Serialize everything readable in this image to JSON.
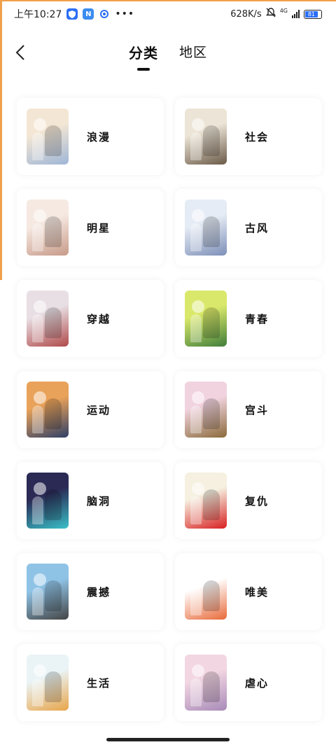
{
  "status_bar": {
    "time": "上午10:27",
    "network_speed": "628K/s",
    "network_type": "4G",
    "battery_level": "81",
    "icons": [
      "shield-icon",
      "n-app-icon",
      "circle-app-icon",
      "more-dots-icon",
      "mute-bell-icon",
      "signal-icon",
      "battery-icon"
    ]
  },
  "header": {
    "back_icon": "chevron-left-icon",
    "tabs": [
      {
        "label": "分类",
        "active": true
      },
      {
        "label": "地区",
        "active": false
      }
    ]
  },
  "categories": [
    {
      "label": "浪漫",
      "thumb_colors": [
        "#f3e6d4",
        "#9fb6d6"
      ]
    },
    {
      "label": "社会",
      "thumb_colors": [
        "#ece4d6",
        "#6b5a48"
      ]
    },
    {
      "label": "明星",
      "thumb_colors": [
        "#f6e9e2",
        "#c79a88"
      ]
    },
    {
      "label": "古风",
      "thumb_colors": [
        "#e6ecf5",
        "#7d8fb8"
      ]
    },
    {
      "label": "穿越",
      "thumb_colors": [
        "#e8dfe4",
        "#b04a4a"
      ]
    },
    {
      "label": "青春",
      "thumb_colors": [
        "#d9e86a",
        "#3f7d3a"
      ]
    },
    {
      "label": "运动",
      "thumb_colors": [
        "#e9a25a",
        "#2f3f66"
      ]
    },
    {
      "label": "宫斗",
      "thumb_colors": [
        "#f1d3df",
        "#8a6a3a"
      ]
    },
    {
      "label": "脑洞",
      "thumb_colors": [
        "#2a2a55",
        "#3ac0c8"
      ]
    },
    {
      "label": "复仇",
      "thumb_colors": [
        "#f5f0e0",
        "#d82020"
      ]
    },
    {
      "label": "震撼",
      "thumb_colors": [
        "#8fc3e6",
        "#444444"
      ]
    },
    {
      "label": "唯美",
      "thumb_colors": [
        "#ffffff",
        "#e86a3a"
      ]
    },
    {
      "label": "生活",
      "thumb_colors": [
        "#eaf4f6",
        "#e8a54a"
      ]
    },
    {
      "label": "虐心",
      "thumb_colors": [
        "#f2d6e2",
        "#a88ab8"
      ]
    }
  ],
  "colors": {
    "accent": "#111111",
    "battery": "#2b6ef5",
    "card_bg": "#ffffff",
    "page_bg": "#ffffff"
  }
}
